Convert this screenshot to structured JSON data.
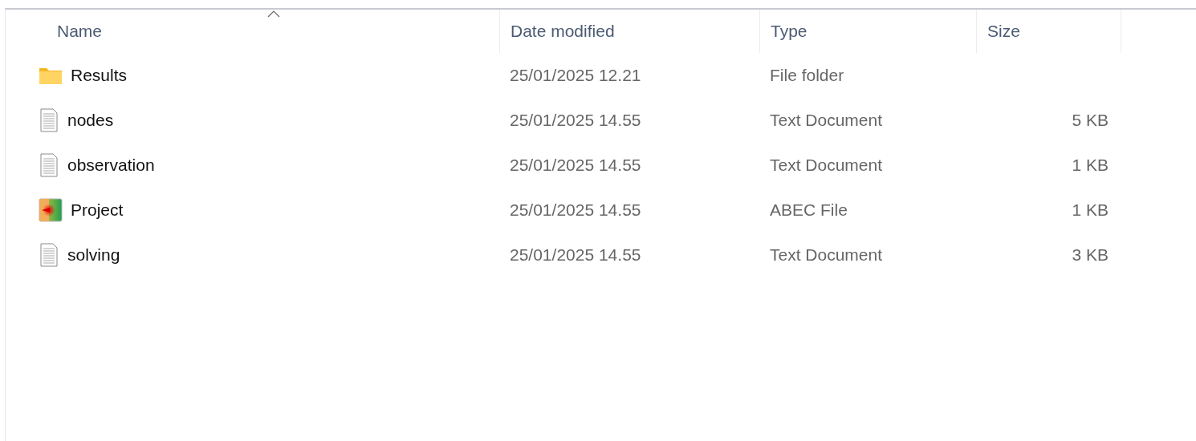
{
  "columns": [
    {
      "label": "Name",
      "sorted": true
    },
    {
      "label": "Date modified",
      "sorted": false
    },
    {
      "label": "Type",
      "sorted": false
    },
    {
      "label": "Size",
      "sorted": false
    }
  ],
  "rows": [
    {
      "kind": "folder",
      "name": "Results",
      "date": "25/01/2025 12.21",
      "type": "File folder"
    },
    {
      "kind": "text",
      "name": "nodes",
      "date": "25/01/2025 14.55",
      "type": "Text Document",
      "size": "5 KB"
    },
    {
      "kind": "text",
      "name": "observation",
      "date": "25/01/2025 14.55",
      "type": "Text Document",
      "size": "1 KB"
    },
    {
      "kind": "abec",
      "name": "Project",
      "date": "25/01/2025 14.55",
      "type": "ABEC File",
      "size": "1 KB"
    },
    {
      "kind": "text",
      "name": "solving",
      "date": "25/01/2025 14.55",
      "type": "Text Document",
      "size": "3 KB"
    }
  ]
}
